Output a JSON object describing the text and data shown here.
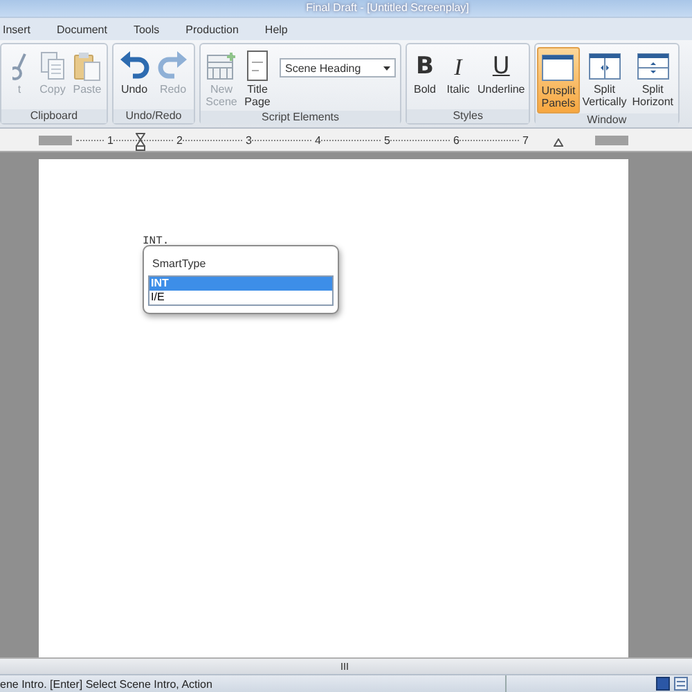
{
  "window": {
    "title": "Final Draft - [Untitled Screenplay]"
  },
  "menu": [
    {
      "label": "Insert"
    },
    {
      "label": "Document"
    },
    {
      "label": "Tools"
    },
    {
      "label": "Production"
    },
    {
      "label": "Help"
    }
  ],
  "ribbon": [
    {
      "label": "Clipboard",
      "buttons": [
        {
          "kind": "cut",
          "label": "t",
          "disabled": true
        },
        {
          "kind": "copy",
          "label": "Copy",
          "disabled": true
        },
        {
          "kind": "paste",
          "label": "Paste",
          "disabled": true
        }
      ]
    },
    {
      "label": "Undo/Redo",
      "buttons": [
        {
          "kind": "undo",
          "label": "Undo",
          "disabled": false
        },
        {
          "kind": "redo",
          "label": "Redo",
          "disabled": true
        }
      ]
    },
    {
      "label": "Script Elements",
      "buttons": [
        {
          "kind": "new-scene",
          "label": "New Scene",
          "disabled": true
        },
        {
          "kind": "title-page",
          "label": "Title Page",
          "disabled": false
        },
        {
          "kind": "dropdown",
          "value": "Scene Heading"
        }
      ]
    },
    {
      "label": "Styles",
      "buttons": [
        {
          "kind": "bold",
          "glyph": "B",
          "label": "Bold",
          "disabled": false
        },
        {
          "kind": "italic",
          "glyph": "I",
          "label": "Italic",
          "disabled": false
        },
        {
          "kind": "underline",
          "glyph": "U",
          "label": "Underline",
          "disabled": false
        }
      ]
    },
    {
      "label": "Window",
      "buttons": [
        {
          "kind": "unsplit",
          "label": "Unsplit Panels",
          "selected": true
        },
        {
          "kind": "split-v",
          "label": "Split Vertically",
          "selected": false
        },
        {
          "kind": "split-h",
          "label": "Split Horizont",
          "selected": false
        }
      ]
    }
  ],
  "ruler": {
    "numbers": [
      "1",
      "2",
      "3",
      "4",
      "5",
      "6",
      "7"
    ]
  },
  "document": {
    "text": "INT."
  },
  "smarttype": {
    "title": "SmartType",
    "items": [
      {
        "label": "INT",
        "selected": true
      },
      {
        "label": "I/E",
        "selected": false
      }
    ]
  },
  "status_bar": {
    "text": "ene Intro.  [Enter] Select Scene Intro, Action"
  }
}
